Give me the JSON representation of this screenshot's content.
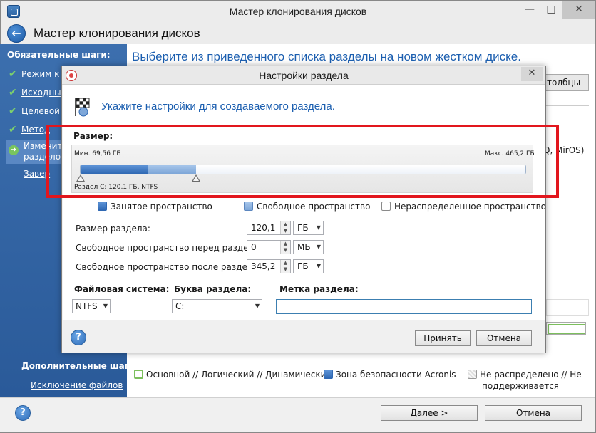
{
  "window": {
    "title": "Мастер клонирования дисков",
    "header_title": "Мастер клонирования дисков",
    "controls": {
      "minimize": "—",
      "maximize": "□",
      "close": "✕"
    }
  },
  "sidebar": {
    "required_header": "Обязательные шаги:",
    "items": [
      {
        "label": "Режим к",
        "done": true
      },
      {
        "label": "Исходны",
        "done": true
      },
      {
        "label": "Целевой",
        "done": true
      },
      {
        "label": "Метод",
        "done": true
      },
      {
        "label": "Изменит",
        "label2": "раздело",
        "active": true
      },
      {
        "label": "Завер",
        "done": false
      }
    ],
    "optional_header": "Дополнительные шаги:",
    "optional_link": "Исключение файлов"
  },
  "main": {
    "heading": "Выберите из приведенного списка разделы на новом жестком диске.",
    "columns_button": "толбцы",
    "right_text": "Q, MirOS)"
  },
  "legend": {
    "primary": "Основной // Логический // Динамический",
    "acronis": "Зона безопасности Acronis",
    "unallocated_line1": "Не распределено // Не",
    "unallocated_line2": "поддерживается"
  },
  "footer": {
    "next_label": "Далее >",
    "cancel_label": "Отмена"
  },
  "dialog": {
    "title": "Настройки раздела",
    "close": "✕",
    "heading": "Укажите настройки для создаваемого раздела.",
    "size_label": "Размер:",
    "min_label": "Мин. 69,56 ГБ",
    "max_label": "Макс. 465,2 ГБ",
    "partition_info": "Раздел C: 120,1 ГБ, NTFS",
    "slider": {
      "used_fraction": 0.15,
      "partition_fraction": 0.26,
      "total_gb": 465.2
    },
    "legend": {
      "used": "Занятое пространство",
      "free": "Свободное пространство",
      "unallocated": "Нераспределенное пространство"
    },
    "fields": {
      "size": {
        "label": "Размер раздела:",
        "value": "120,1",
        "unit": "ГБ"
      },
      "free_before": {
        "label": "Свободное пространство перед разделом:",
        "value": "0",
        "unit": "МБ"
      },
      "free_after": {
        "label": "Свободное пространство после раздела:",
        "value": "345,2",
        "unit": "ГБ"
      }
    },
    "fs_header": "Файловая система:",
    "fs_value": "NTFS",
    "letter_header": "Буква раздела:",
    "letter_value": "C:",
    "label_header": "Метка раздела:",
    "label_value": "",
    "accept_label": "Принять",
    "cancel_label": "Отмена"
  },
  "colors": {
    "accent": "#1c5fb0",
    "sidebar": "#3c6fae",
    "used_fill": "#2f68b3",
    "free_fill": "#7da6d8",
    "highlight": "#e2161d"
  }
}
